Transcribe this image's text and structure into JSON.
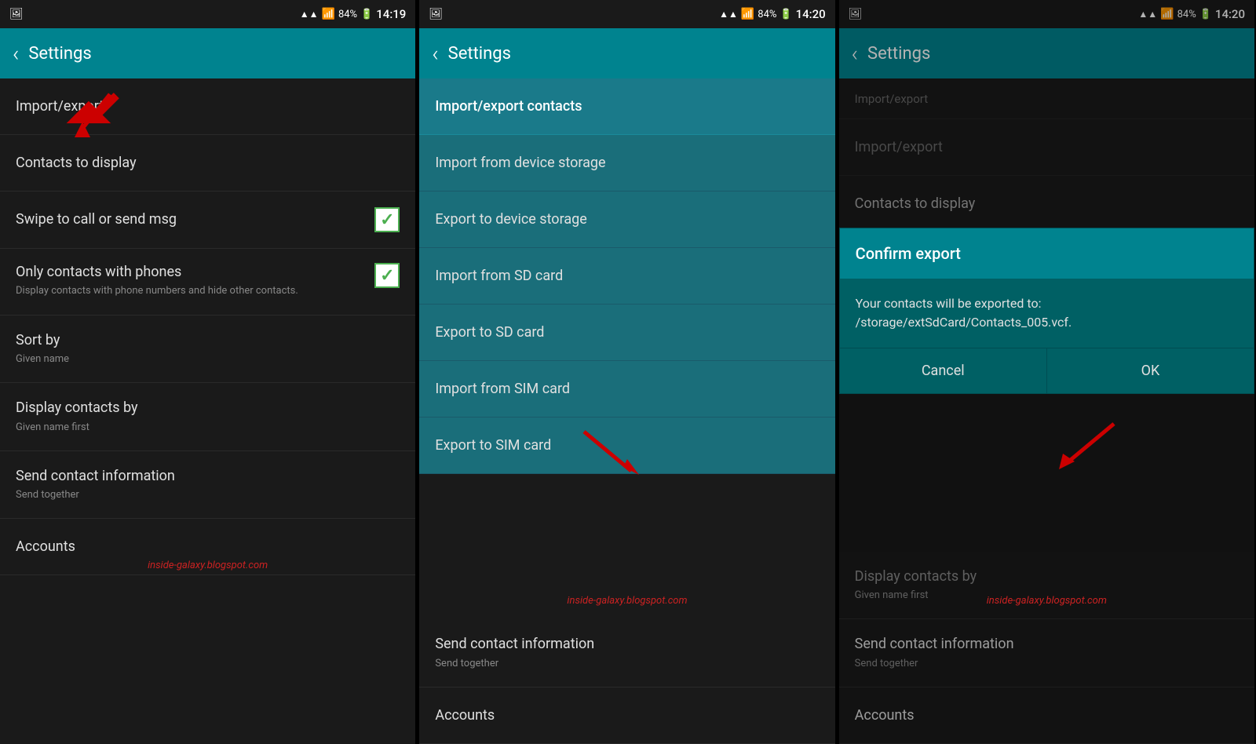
{
  "panels": [
    {
      "id": "panel1",
      "statusBar": {
        "leftIcon": "📷",
        "signal": "▲▲▲",
        "wifi": "wifi",
        "battery": "84%",
        "time": "14:19"
      },
      "appBar": {
        "backLabel": "‹",
        "title": "Settings"
      },
      "settingsItems": [
        {
          "id": "import-export",
          "title": "Import/export",
          "subtitle": "",
          "hasCheckbox": false,
          "checkboxChecked": false,
          "showArrow": true
        },
        {
          "id": "contacts-to-display",
          "title": "Contacts to display",
          "subtitle": "",
          "hasCheckbox": false,
          "checkboxChecked": false,
          "showArrow": false
        },
        {
          "id": "swipe-call",
          "title": "Swipe to call or send msg",
          "subtitle": "",
          "hasCheckbox": true,
          "checkboxChecked": true,
          "showArrow": false
        },
        {
          "id": "only-with-phones",
          "title": "Only contacts with phones",
          "subtitle": "Display contacts with phone numbers and hide other contacts.",
          "hasCheckbox": true,
          "checkboxChecked": true,
          "showArrow": false
        },
        {
          "id": "sort-by",
          "title": "Sort by",
          "subtitle": "Given name",
          "hasCheckbox": false,
          "checkboxChecked": false,
          "showArrow": false
        },
        {
          "id": "display-contacts-by",
          "title": "Display contacts by",
          "subtitle": "Given name first",
          "hasCheckbox": false,
          "checkboxChecked": false,
          "showArrow": false
        },
        {
          "id": "send-contact-info",
          "title": "Send contact information",
          "subtitle": "Send together",
          "hasCheckbox": false,
          "checkboxChecked": false,
          "showArrow": false
        },
        {
          "id": "accounts",
          "title": "Accounts",
          "subtitle": "",
          "hasCheckbox": false,
          "checkboxChecked": false,
          "showArrow": false
        }
      ]
    },
    {
      "id": "panel2",
      "statusBar": {
        "leftIcon": "📷",
        "signal": "▲▲▲",
        "wifi": "wifi",
        "battery": "84%",
        "time": "14:20"
      },
      "appBar": {
        "backLabel": "‹",
        "title": "Settings"
      },
      "sectionLabel": "Import/export",
      "importExportMenu": {
        "header": "Import/export contacts",
        "items": [
          "Import from device storage",
          "Export to device storage",
          "Import from SD card",
          "Export to SD card",
          "Import from SIM card",
          "Export to SIM card"
        ]
      },
      "belowItems": [
        {
          "id": "send-contact-info-2",
          "title": "Send contact information",
          "subtitle": "Send together"
        },
        {
          "id": "accounts-2",
          "title": "Accounts",
          "subtitle": ""
        }
      ]
    },
    {
      "id": "panel3",
      "statusBar": {
        "leftIcon": "📷",
        "signal": "▲▲▲",
        "wifi": "wifi",
        "battery": "84%",
        "time": "14:20"
      },
      "appBar": {
        "backLabel": "‹",
        "title": "Settings"
      },
      "sectionLabel": "Import/export",
      "dialog": {
        "title": "Confirm export",
        "body": "Your contacts will be exported to: /storage/extSdCard/Contacts_005.vcf.",
        "cancelLabel": "Cancel",
        "okLabel": "OK"
      },
      "belowDialog": [
        {
          "id": "contacts-to-display-3",
          "title": "Contacts to display",
          "subtitle": ""
        },
        {
          "id": "display-contacts-by-3",
          "title": "Display contacts by",
          "subtitle": "Given name first"
        },
        {
          "id": "send-contact-info-3",
          "title": "Send contact information",
          "subtitle": "Send together"
        },
        {
          "id": "accounts-3",
          "title": "Accounts",
          "subtitle": ""
        }
      ]
    }
  ],
  "watermark": "inside-galaxy.blogspot.com"
}
